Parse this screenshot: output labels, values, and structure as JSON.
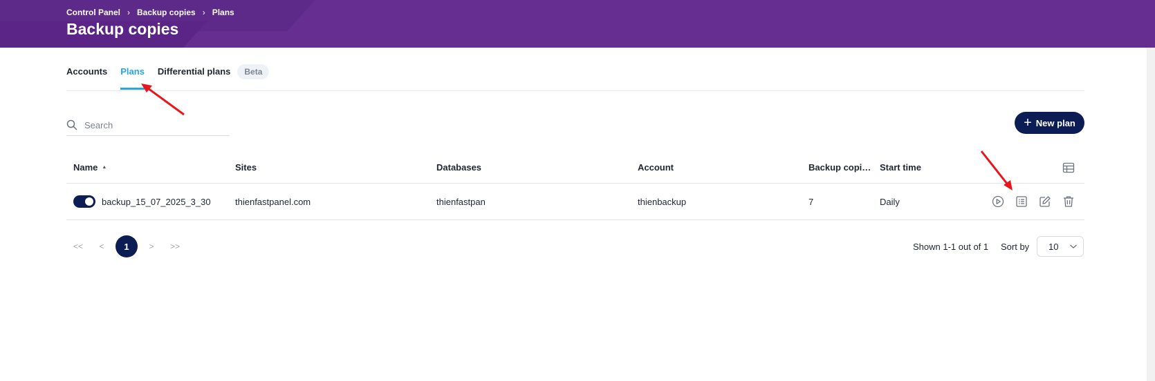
{
  "header": {
    "breadcrumb": [
      "Control Panel",
      "Backup copies",
      "Plans"
    ],
    "title": "Backup copies"
  },
  "tabs": [
    {
      "label": "Accounts"
    },
    {
      "label": "Plans"
    },
    {
      "label": "Differential plans"
    }
  ],
  "beta_badge": "Beta",
  "search": {
    "placeholder": "Search"
  },
  "new_plan_button": "New plan",
  "table": {
    "columns": [
      "Name",
      "Sites",
      "Databases",
      "Account",
      "Backup copi…",
      "Start time"
    ],
    "rows": [
      {
        "enabled": true,
        "name": "backup_15_07_2025_3_30",
        "sites": "thienfastpanel.com",
        "databases": "thienfastpan",
        "account": "thienbackup",
        "backup_copies": "7",
        "start_time": "Daily"
      }
    ]
  },
  "pagination": {
    "first": "<<",
    "prev": "<",
    "current": "1",
    "next": ">",
    "last": ">>",
    "info": "Shown 1-1 out of 1",
    "sort_label": "Sort by",
    "per_page": "10"
  },
  "colors": {
    "header_bg": "#662e91",
    "accent": "#27a6e6",
    "primary": "#0c1d55",
    "annotation_arrow": "#e8161b"
  }
}
